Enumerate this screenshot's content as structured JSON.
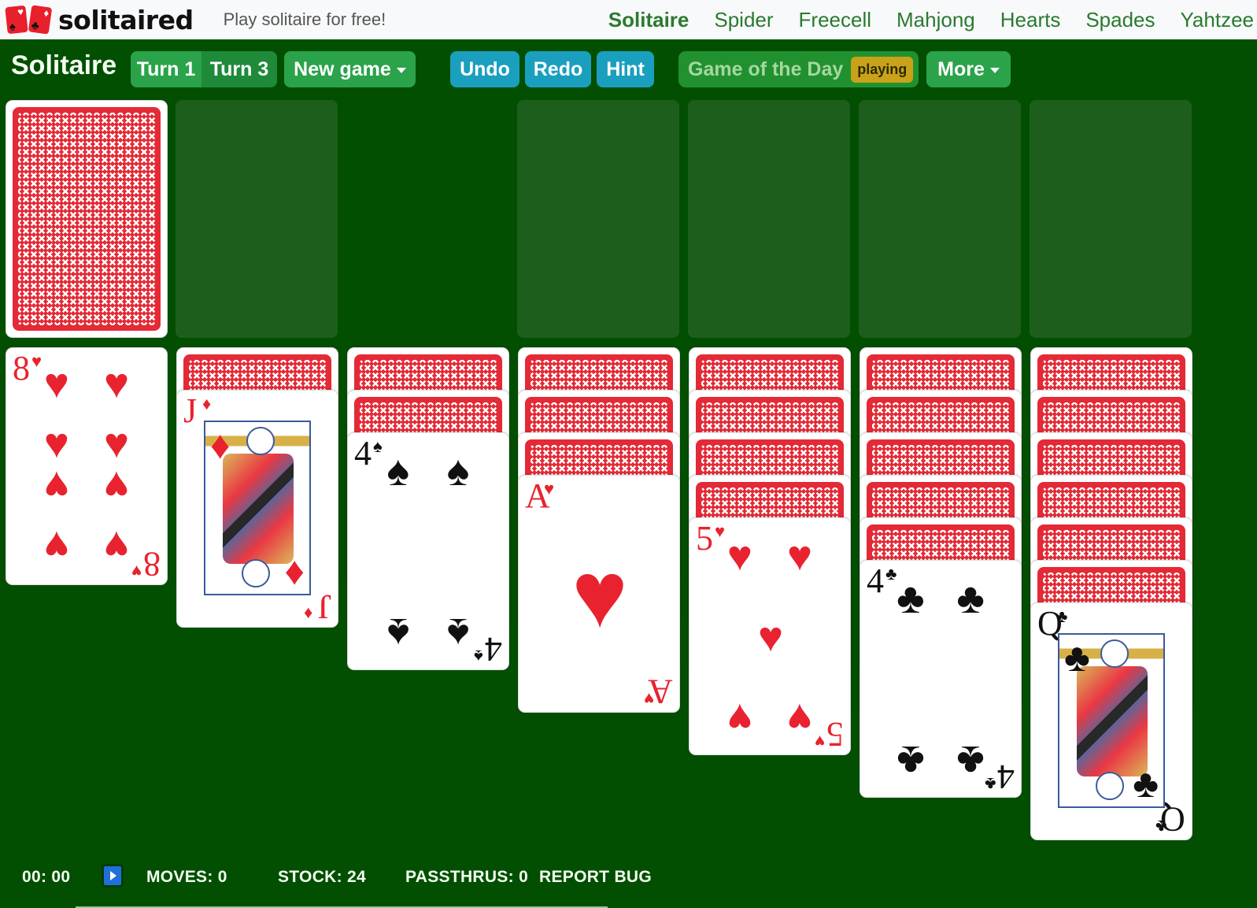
{
  "nav": {
    "brand": "solitaired",
    "tagline": "Play solitaire for free!",
    "logo_suits": [
      "heart",
      "spade",
      "diamond",
      "club"
    ],
    "links": [
      {
        "label": "Solitaire",
        "active": true
      },
      {
        "label": "Spider",
        "active": false
      },
      {
        "label": "Freecell",
        "active": false
      },
      {
        "label": "Mahjong",
        "active": false
      },
      {
        "label": "Hearts",
        "active": false
      },
      {
        "label": "Spades",
        "active": false
      },
      {
        "label": "Yahtzee",
        "active": false
      }
    ]
  },
  "toolbar": {
    "title": "Solitaire",
    "turn1_label": "Turn 1",
    "turn3_label": "Turn 3",
    "selected_turn": "Turn 3",
    "new_game_label": "New game",
    "undo_label": "Undo",
    "redo_label": "Redo",
    "hint_label": "Hint",
    "game_of_day_label": "Game of the Day",
    "game_of_day_badge": "playing",
    "more_label": "More"
  },
  "board": {
    "stock": {
      "face_down_count": 1,
      "label": "stock"
    },
    "waste": {
      "cards": []
    },
    "foundations": [
      {
        "cards": []
      },
      {
        "cards": []
      },
      {
        "cards": []
      },
      {
        "cards": []
      }
    ],
    "tableau": [
      {
        "face_down": 0,
        "top": {
          "rank": "8",
          "suit": "♥",
          "color": "red"
        }
      },
      {
        "face_down": 1,
        "top": {
          "rank": "J",
          "suit": "♦",
          "color": "red"
        }
      },
      {
        "face_down": 2,
        "top": {
          "rank": "4",
          "suit": "♠",
          "color": "black"
        }
      },
      {
        "face_down": 3,
        "top": {
          "rank": "A",
          "suit": "♥",
          "color": "red"
        }
      },
      {
        "face_down": 4,
        "top": {
          "rank": "5",
          "suit": "♥",
          "color": "red"
        }
      },
      {
        "face_down": 5,
        "top": {
          "rank": "4",
          "suit": "♣",
          "color": "black"
        }
      },
      {
        "face_down": 6,
        "top": {
          "rank": "Q",
          "suit": "♣",
          "color": "black"
        }
      }
    ]
  },
  "status": {
    "timer": "00: 00",
    "moves": "MOVES: 0",
    "stock": "STOCK: 24",
    "passthrus": "PASSTHRUS: 0",
    "report_bug": "REPORT BUG"
  },
  "colors": {
    "felt": "#024f02",
    "slot": "#1d5e1d",
    "card_red": "#e8232f",
    "button_green": "#2aa34a",
    "button_blue": "#1b9fbe",
    "badge_yellow": "#c9a21a",
    "nav_link": "#2a7a30"
  }
}
